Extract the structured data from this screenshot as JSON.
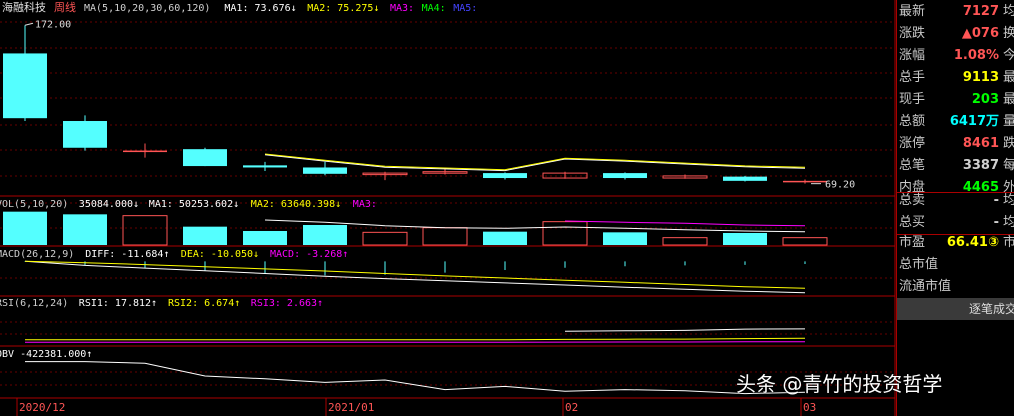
{
  "chart_data": {
    "type": "candlestick",
    "period": "周线",
    "stock_name": "海融科技",
    "x_labels": [
      "2020/12",
      "2021/01",
      "02",
      "03"
    ],
    "candles": [
      {
        "o": 106.0,
        "h": 172.0,
        "l": 104.0,
        "c": 152.0,
        "dir": "down"
      },
      {
        "o": 104.0,
        "h": 108.0,
        "l": 83.0,
        "c": 85.0,
        "dir": "down"
      },
      {
        "o": 83.0,
        "h": 88.0,
        "l": 78.0,
        "c": 83.0,
        "dir": "flat"
      },
      {
        "o": 84.0,
        "h": 85.0,
        "l": 72.0,
        "c": 72.0,
        "dir": "down"
      },
      {
        "o": 72.5,
        "h": 75.0,
        "l": 68.5,
        "c": 71.0,
        "dir": "down"
      },
      {
        "o": 71.0,
        "h": 75.0,
        "l": 65.5,
        "c": 66.5,
        "dir": "down"
      },
      {
        "o": 67.0,
        "h": 68.0,
        "l": 62.0,
        "c": 67.0,
        "dir": "up"
      },
      {
        "o": 67.0,
        "h": 71.0,
        "l": 66.0,
        "c": 68.0,
        "dir": "up"
      },
      {
        "o": 67.0,
        "h": 67.5,
        "l": 62.5,
        "c": 63.5,
        "dir": "down"
      },
      {
        "o": 63.5,
        "h": 68.0,
        "l": 63.0,
        "c": 67.0,
        "dir": "up"
      },
      {
        "o": 67.0,
        "h": 67.5,
        "l": 62.5,
        "c": 63.5,
        "dir": "down"
      },
      {
        "o": 63.5,
        "h": 66.0,
        "l": 63.0,
        "c": 65.0,
        "dir": "up"
      },
      {
        "o": 64.5,
        "h": 65.0,
        "l": 61.0,
        "c": 61.5,
        "dir": "down"
      },
      {
        "o": 61.5,
        "h": 62.5,
        "l": 59.5,
        "c": 61.0,
        "dir": "flat"
      }
    ],
    "ma_line": [
      null,
      null,
      null,
      null,
      80.0,
      75.5,
      71.2,
      70.0,
      68.8,
      77.0,
      75.5,
      73.5,
      71.5,
      70.5
    ],
    "price_ylim": [
      55,
      180
    ],
    "price_labels": [
      "172.00",
      "69.20"
    ],
    "ma_legend": [
      {
        "text": "MA(5,10,20,30,60,120)",
        "color": "#d0d0d0"
      },
      {
        "text": "MA1: 73.676↓",
        "color": "#ffffff"
      },
      {
        "text": "MA2: 75.275↓",
        "color": "#ffff00"
      },
      {
        "text": "MA3:",
        "color": "#ff00ff"
      },
      {
        "text": "MA4:",
        "color": "#00ff00"
      },
      {
        "text": "MA5:",
        "color": "#4444ff"
      }
    ],
    "volume": {
      "legend": [
        {
          "text": "VOL(5,10,20)",
          "color": "#d0d0d0"
        },
        {
          "text": "35084.000↓",
          "color": "#ffffff"
        },
        {
          "text": "MA1: 50253.602↓",
          "color": "#ffffff"
        },
        {
          "text": "MA2: 63640.398↓",
          "color": "#ffff00"
        },
        {
          "text": "MA3:",
          "color": "#ff00ff"
        }
      ],
      "values": [
        100,
        92,
        88,
        55,
        42,
        60,
        38,
        52,
        40,
        70,
        38,
        22,
        36,
        22
      ],
      "ma1": [
        null,
        null,
        null,
        null,
        75,
        68,
        58,
        52,
        50,
        54,
        50,
        46,
        42,
        40
      ],
      "ma2": [
        null,
        null,
        null,
        null,
        null,
        null,
        null,
        null,
        null,
        72,
        68,
        65,
        60,
        58
      ],
      "ylim": [
        0,
        105
      ]
    },
    "macd": {
      "legend": [
        {
          "text": "MACD(26,12,9)",
          "color": "#d0d0d0"
        },
        {
          "text": "DIFF: -11.684↑",
          "color": "#ffffff"
        },
        {
          "text": "DEA: -10.050↓",
          "color": "#ffff00"
        },
        {
          "text": "MACD: -3.268↑",
          "color": "#ff00ff"
        }
      ],
      "hist": [
        -0.2,
        -1.5,
        -2.5,
        -3.5,
        -4.5,
        -5.2,
        -5.0,
        -4.2,
        -3.2,
        -2.4,
        -1.8,
        -1.5,
        -1.3,
        -1.0
      ],
      "diff": [
        0.0,
        -1.5,
        -2.5,
        -3.5,
        -4.5,
        -5.5,
        -6.4,
        -7.2,
        -8.0,
        -8.8,
        -9.6,
        -10.4,
        -11.1,
        -11.7
      ],
      "dea": [
        0.0,
        -0.5,
        -1.2,
        -2.0,
        -2.8,
        -3.6,
        -4.5,
        -5.4,
        -6.2,
        -7.0,
        -7.8,
        -8.6,
        -9.4,
        -10.0
      ],
      "ylim": [
        -12.5,
        0.5
      ]
    },
    "rsi": {
      "legend": [
        {
          "text": "RSI(6,12,24)",
          "color": "#d0d0d0"
        },
        {
          "text": "RSI1: 17.812↑",
          "color": "#ffffff"
        },
        {
          "text": "RSI2: 6.674↑",
          "color": "#ffff00"
        },
        {
          "text": "RSI3: 2.663↑",
          "color": "#ff00ff"
        }
      ],
      "rsi1": [
        null,
        null,
        null,
        null,
        null,
        null,
        null,
        null,
        null,
        15.0,
        15.5,
        16.0,
        17.5,
        17.8
      ],
      "rsi2": [
        5.0,
        5.0,
        5.0,
        5.0,
        5.0,
        5.0,
        5.0,
        5.0,
        5.0,
        5.4,
        5.6,
        5.8,
        6.4,
        6.7
      ],
      "rsi3": [
        2.0,
        2.0,
        2.0,
        2.0,
        2.0,
        2.0,
        2.0,
        2.0,
        2.0,
        2.2,
        2.3,
        2.4,
        2.6,
        2.7
      ],
      "ylim": [
        0,
        40
      ]
    },
    "obv": {
      "legend": [
        {
          "text": "OBV -422381.000↑",
          "color": "#ffffff"
        }
      ],
      "values": [
        -40000,
        -40000,
        -60000,
        -220000,
        -255000,
        -300000,
        -270000,
        -390000,
        -350000,
        -410000,
        -390000,
        -405000,
        -440000,
        -422381
      ],
      "ylim": [
        -470000,
        -20000
      ]
    }
  },
  "quote": {
    "rows": [
      {
        "label": "最新",
        "value": "7127",
        "color": "#ff5555",
        "cut": "均"
      },
      {
        "label": "涨跌",
        "value": "▲076",
        "color": "#ff5555",
        "cut": "换"
      },
      {
        "label": "涨幅",
        "value": "1.08%",
        "color": "#ff5555",
        "cut": "今"
      },
      {
        "label": "总手",
        "value": "9113",
        "color": "#ffff00",
        "cut": "最"
      },
      {
        "label": "现手",
        "value": "203",
        "color": "#00ff00",
        "cut": "最"
      },
      {
        "label": "总额",
        "value": "6417万",
        "color": "#00ffff",
        "cut": "量"
      },
      {
        "label": "涨停",
        "value": "8461",
        "color": "#ff5555",
        "cut": "跌"
      },
      {
        "label": "总笔",
        "value": "3387",
        "color": "#d0d0d0",
        "cut": "每"
      },
      {
        "label": "内盘",
        "value": "4465",
        "color": "#00ff00",
        "cut": "外"
      }
    ],
    "rows2": [
      {
        "label": "总卖",
        "value": "-",
        "color": "#d0d0d0",
        "cut": "均"
      },
      {
        "label": "总买",
        "value": "-",
        "color": "#d0d0d0",
        "cut": "均"
      }
    ],
    "rows3": [
      {
        "label": "市盈",
        "value": "66.41③",
        "color": "#ffff00",
        "cut": "市"
      },
      {
        "label": "总市值",
        "value": "",
        "color": "#d0d0d0",
        "cut": ""
      },
      {
        "label": "流通市值",
        "value": "",
        "color": "#d0d0d0",
        "cut": ""
      }
    ],
    "trade_header": "逐笔成交"
  },
  "watermark": "头条 @青竹的投资哲学"
}
